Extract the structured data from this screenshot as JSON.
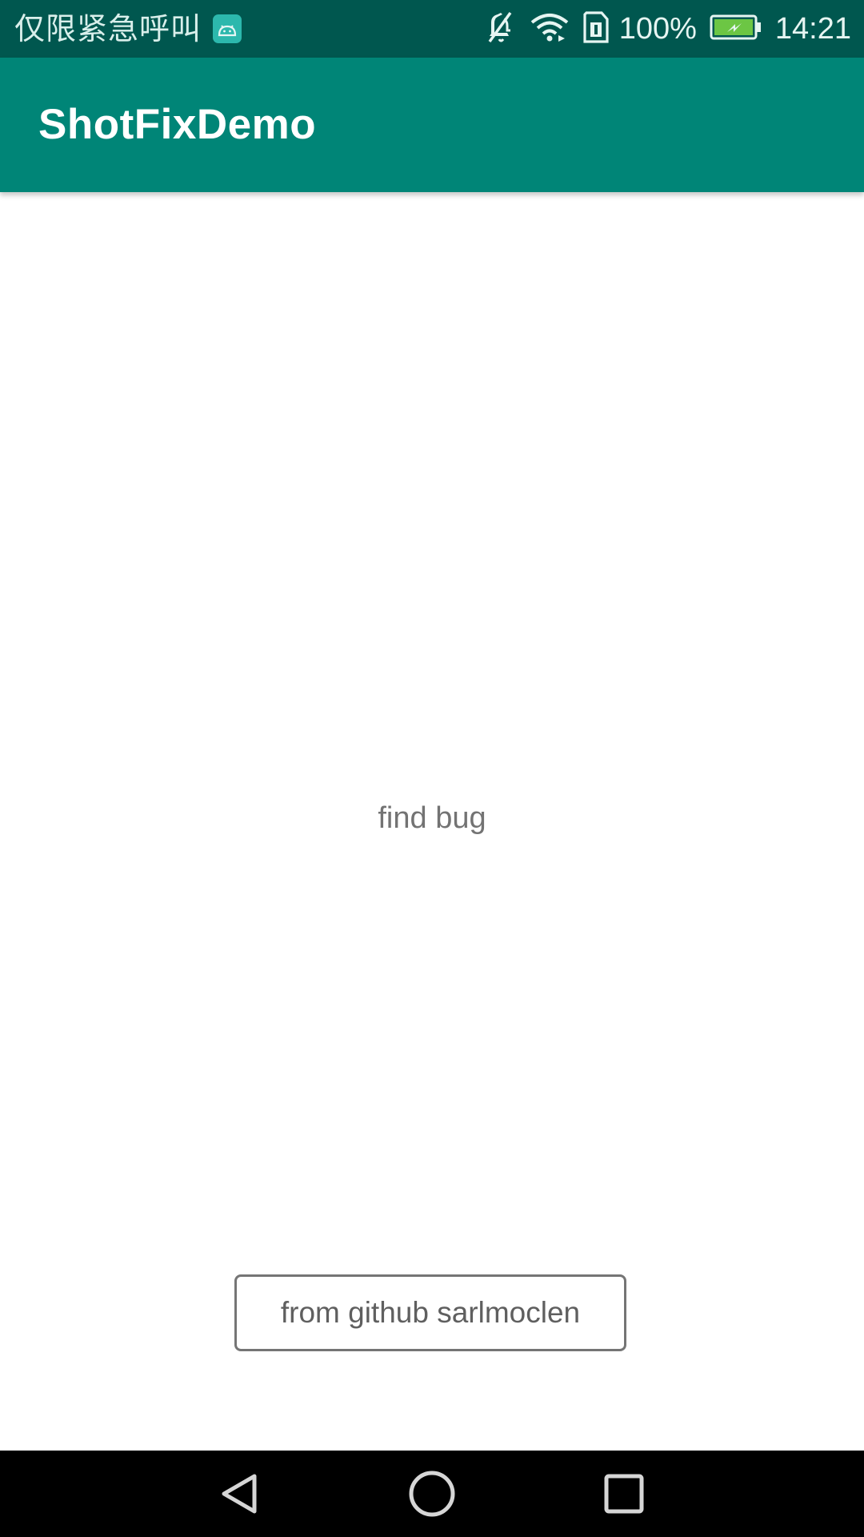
{
  "status_bar": {
    "carrier_text": "仅限紧急呼叫",
    "notification_icon": "android-icon",
    "icons": [
      "mute-icon",
      "wifi-icon",
      "sim-icon"
    ],
    "battery_percent": "100%",
    "battery_icon": "battery-charging-icon",
    "battery_color": "#6cc644",
    "time": "14:21"
  },
  "app_bar": {
    "title": "ShotFixDemo",
    "color": "#008577"
  },
  "main": {
    "center_text": "find bug",
    "button_label": "from github sarlmoclen"
  },
  "nav_bar": {
    "buttons": [
      "back-icon",
      "home-icon",
      "recents-icon"
    ]
  },
  "colors": {
    "status_bar": "#00574f",
    "primary": "#008577",
    "background": "#ffffff",
    "nav_bar": "#000000"
  }
}
